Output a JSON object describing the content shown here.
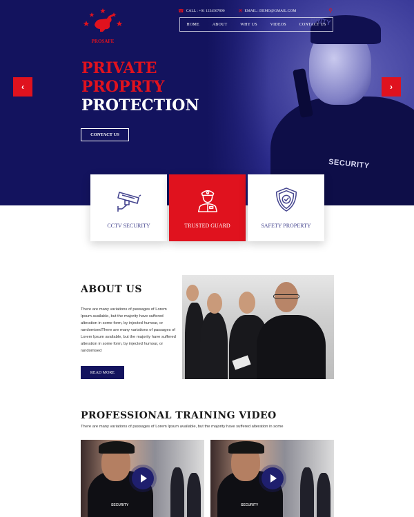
{
  "brand": {
    "name": "PROSAFE",
    "accent": "#e0121e",
    "navy": "#13135e"
  },
  "contact": {
    "phone": "CALL : +01 1234567890",
    "email": "EMAIL : DEMO@GMAIL.COM"
  },
  "nav": [
    "HOME",
    "ABOUT",
    "WHY US",
    "VIDEOS",
    "CONTACT US"
  ],
  "hero": {
    "line1": "PRIVATE",
    "line2": "PROPRTY",
    "line3": "PROTECTION",
    "cta": "CONTACT US",
    "photo_text": "SECURITY",
    "cap_text": "PRITY"
  },
  "features": [
    {
      "label": "CCTV SECURITY",
      "icon": "cctv-icon",
      "active": false
    },
    {
      "label": "TRUSTED GUARD",
      "icon": "guard-icon",
      "active": true
    },
    {
      "label": "SAFETY PROPERTY",
      "icon": "shield-check-icon",
      "active": false
    }
  ],
  "about": {
    "title": "ABOUT US",
    "text": "There are many variations of passages of Lorem Ipsum available, but the majority have suffered alteration in some form, by injected humour, or randomisedThere are many variations of passages of Lorem Ipsum available, but the majority have suffered alteration in some form, by injected humour, or randomised",
    "button": "READ MORE"
  },
  "training": {
    "title": "PROFESSIONAL TRAINING VIDEO",
    "text": "There are many variations of passages of Lorem Ipsum available, but the majority have suffered alteration in some",
    "video_label": "SECURITY"
  }
}
